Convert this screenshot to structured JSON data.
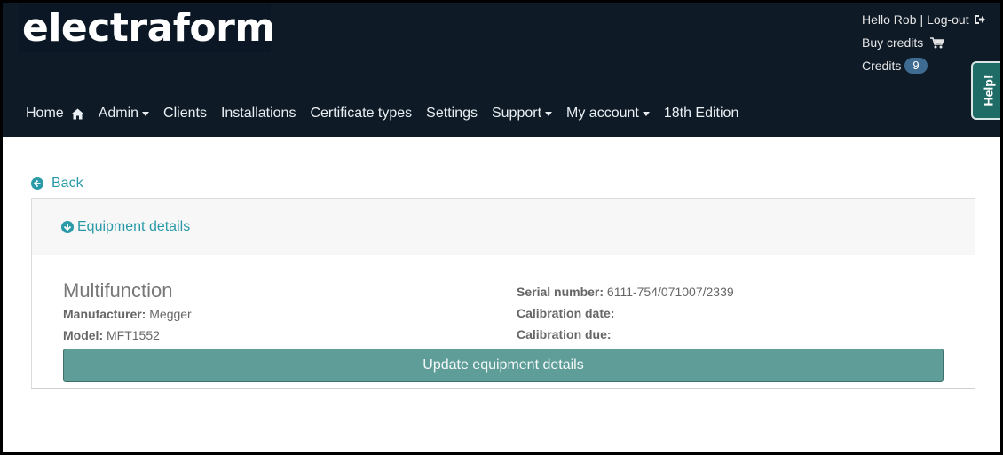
{
  "header": {
    "logo_text": "electraform",
    "greeting": "Hello Rob",
    "separator": "|",
    "logout": "Log-out",
    "buy_credits": "Buy credits",
    "credits_label": "Credits",
    "credits_count": "9",
    "help": "Help!"
  },
  "nav": {
    "items": [
      {
        "label": "Home",
        "icon": "home-icon"
      },
      {
        "label": "Admin",
        "dropdown": true
      },
      {
        "label": "Clients"
      },
      {
        "label": "Installations"
      },
      {
        "label": "Certificate types"
      },
      {
        "label": "Settings"
      },
      {
        "label": "Support",
        "dropdown": true
      },
      {
        "label": "My account",
        "dropdown": true
      },
      {
        "label": "18th Edition"
      }
    ]
  },
  "page": {
    "back": "Back",
    "panel_title": "Equipment details",
    "equipment": {
      "name": "Multifunction",
      "manufacturer_label": "Manufacturer:",
      "manufacturer": "Megger",
      "model_label": "Model:",
      "model": "MFT1552",
      "serial_label": "Serial number:",
      "serial": "6111-754/071007/2339",
      "calibration_date_label": "Calibration date:",
      "calibration_date": "",
      "calibration_due_label": "Calibration due:",
      "calibration_due": ""
    },
    "update_button": "Update equipment details"
  },
  "colors": {
    "header_bg": "#0e1a26",
    "link": "#2a9aa8",
    "button_bg": "#5f9e98",
    "badge_bg": "#3e6b92",
    "help_bg": "#1f6b66"
  }
}
